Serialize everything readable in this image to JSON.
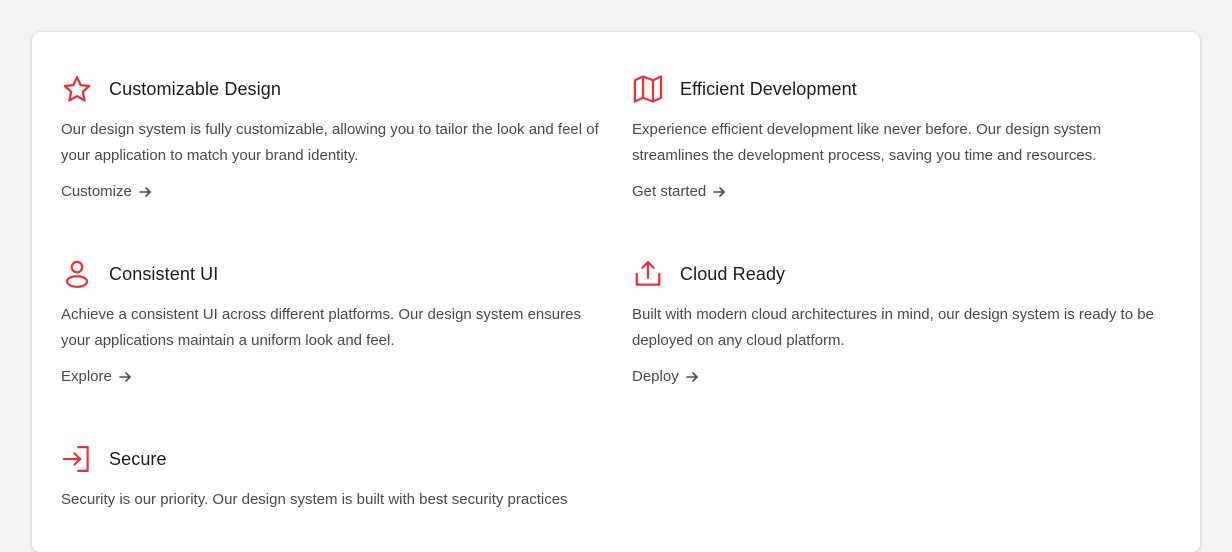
{
  "features": [
    {
      "icon": "star-icon",
      "title": "Customizable Design",
      "description": "Our design system is fully customizable, allowing you to tailor the look and feel of your application to match your brand identity.",
      "link": "Customize"
    },
    {
      "icon": "map-icon",
      "title": "Efficient Development",
      "description": "Experience efficient development like never before. Our design system streamlines the development process, saving you time and resources.",
      "link": "Get started"
    },
    {
      "icon": "user-icon",
      "title": "Consistent UI",
      "description": "Achieve a consistent UI across different platforms. Our design system ensures your applications maintain a uniform look and feel.",
      "link": "Explore"
    },
    {
      "icon": "upload-icon",
      "title": "Cloud Ready",
      "description": "Built with modern cloud architectures in mind, our design system is ready to be deployed on any cloud platform.",
      "link": "Deploy"
    },
    {
      "icon": "sign-in-icon",
      "title": "Secure",
      "description": "Security is our priority. Our design system is built with best security practices",
      "link": ""
    }
  ],
  "colors": {
    "accent": "#e5323f",
    "title": "#1c1c1c",
    "body": "#4a4a4a",
    "card": "#ffffff",
    "page": "#f3f3f3"
  }
}
